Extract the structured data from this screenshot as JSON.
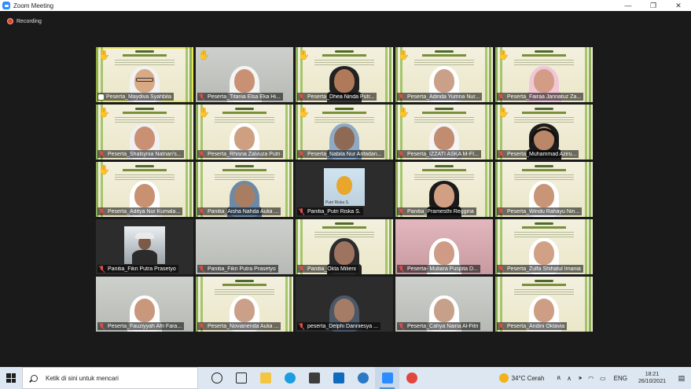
{
  "window": {
    "title": "Zoom Meeting",
    "controls": {
      "minimize": "—",
      "maximize": "❐",
      "close": "✕"
    }
  },
  "recording": {
    "label": "Recording",
    "color": "#e8432f"
  },
  "participants": [
    {
      "name": "Peserta_Maydiva Syahbila",
      "hand": true,
      "muted": false,
      "active": true
    },
    {
      "name": "Peserta_Titania Elsa Eka Hi...",
      "hand": true,
      "muted": true,
      "active": false
    },
    {
      "name": "Peserta_Dhea Ninda Putr...",
      "hand": true,
      "muted": true,
      "active": false
    },
    {
      "name": "Peserta_Adinda Yumna Nur...",
      "hand": true,
      "muted": true,
      "active": false
    },
    {
      "name": "Peserta_Fairaa Jannatuz Za...",
      "hand": true,
      "muted": true,
      "active": false
    },
    {
      "name": "Peserta_Shalsynia Natnan's...",
      "hand": true,
      "muted": true,
      "active": false
    },
    {
      "name": "Peserta_Rhisna Zalvuza Putri",
      "hand": true,
      "muted": true,
      "active": false
    },
    {
      "name": "Peserta_Nabila Nur Arifadan...",
      "hand": true,
      "muted": true,
      "active": false
    },
    {
      "name": "Peserta_IZZATI ASKA M-FI...",
      "hand": true,
      "muted": true,
      "active": false
    },
    {
      "name": "Peserta_Muhammad Aziru...",
      "hand": true,
      "muted": true,
      "active": false
    },
    {
      "name": "Peserta_Aditya Nur Kumala...",
      "hand": true,
      "muted": true,
      "active": false
    },
    {
      "name": "Panitia_Aisha Nahda Aulia ...",
      "hand": false,
      "muted": true,
      "active": false
    },
    {
      "name": "Panitia_Putri Riska S.",
      "hand": false,
      "muted": true,
      "active": false,
      "photo_caption": "Putri Riska S."
    },
    {
      "name": "Panitia_Pramesthi Reggina",
      "hand": false,
      "muted": true,
      "active": false
    },
    {
      "name": "Peserta_Windu Rahayu Nin...",
      "hand": false,
      "muted": true,
      "active": false
    },
    {
      "name": "Panitia_Fikri Putra Prasetyo",
      "hand": false,
      "muted": true,
      "active": false
    },
    {
      "name": "Panitia_Fikri Putra Prasetyo",
      "hand": false,
      "muted": true,
      "active": false
    },
    {
      "name": "Panitia_Okta Milieni",
      "hand": false,
      "muted": true,
      "active": false
    },
    {
      "name": "Peserta- Mutiara Puspita D...",
      "hand": false,
      "muted": true,
      "active": false
    },
    {
      "name": "Peserta_Zulfa Shihatul Imania",
      "hand": false,
      "muted": true,
      "active": false
    },
    {
      "name": "Peserta_Fauziyyah Afri Fara...",
      "hand": false,
      "muted": true,
      "active": false
    },
    {
      "name": "Peserta_Novianenda Aulia ...",
      "hand": false,
      "muted": true,
      "active": false
    },
    {
      "name": "peserta_Delphi Danniesya ...",
      "hand": false,
      "muted": true,
      "active": false
    },
    {
      "name": "Peserta_Cahya Naina Al-Fitri",
      "hand": false,
      "muted": true,
      "active": false
    },
    {
      "name": "Peserta_Andini Oktavia",
      "hand": false,
      "muted": true,
      "active": false
    }
  ],
  "taskbar": {
    "search_placeholder": "Ketik di sini untuk mencari",
    "weather": "34°C  Cerah",
    "language": "ENG",
    "time": "18:21",
    "date": "26/10/2021",
    "icons": [
      "task-view-icon",
      "widgets-icon",
      "file-explorer-icon",
      "edge-icon",
      "store-icon",
      "mail-icon",
      "settings-icon",
      "zoom-icon",
      "chrome-icon"
    ]
  }
}
